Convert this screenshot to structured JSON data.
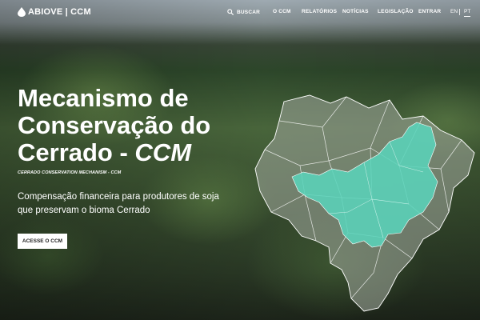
{
  "header": {
    "logo_text": "ABIOVE | CCM",
    "nav": {
      "search": "BUSCAR",
      "items": [
        "O CCM",
        "RELATÓRIOS",
        "NOTÍCIAS",
        "LEGISLAÇÃO",
        "ENTRAR"
      ]
    },
    "languages": {
      "en": "EN",
      "pt": "PT",
      "active": "PT"
    }
  },
  "hero": {
    "title_line1": "Mecanismo de",
    "title_line2": "Conservação do",
    "title_line3_prefix": "Cerrado - ",
    "title_line3_em": "CCM",
    "subtitle_en": "CERRADO CONSERVATION MECHANISM - CCM",
    "description": "Compensação financeira para produtores de soja que preservam o bioma Cerrado",
    "cta_label": "ACESSE O CCM"
  },
  "map": {
    "highlight_color": "#5ad3b9",
    "base_color": "#9aa296",
    "border_color": "#ffffff"
  },
  "colors": {
    "text": "#ffffff",
    "button_bg": "#ffffff",
    "button_text": "#222222"
  }
}
